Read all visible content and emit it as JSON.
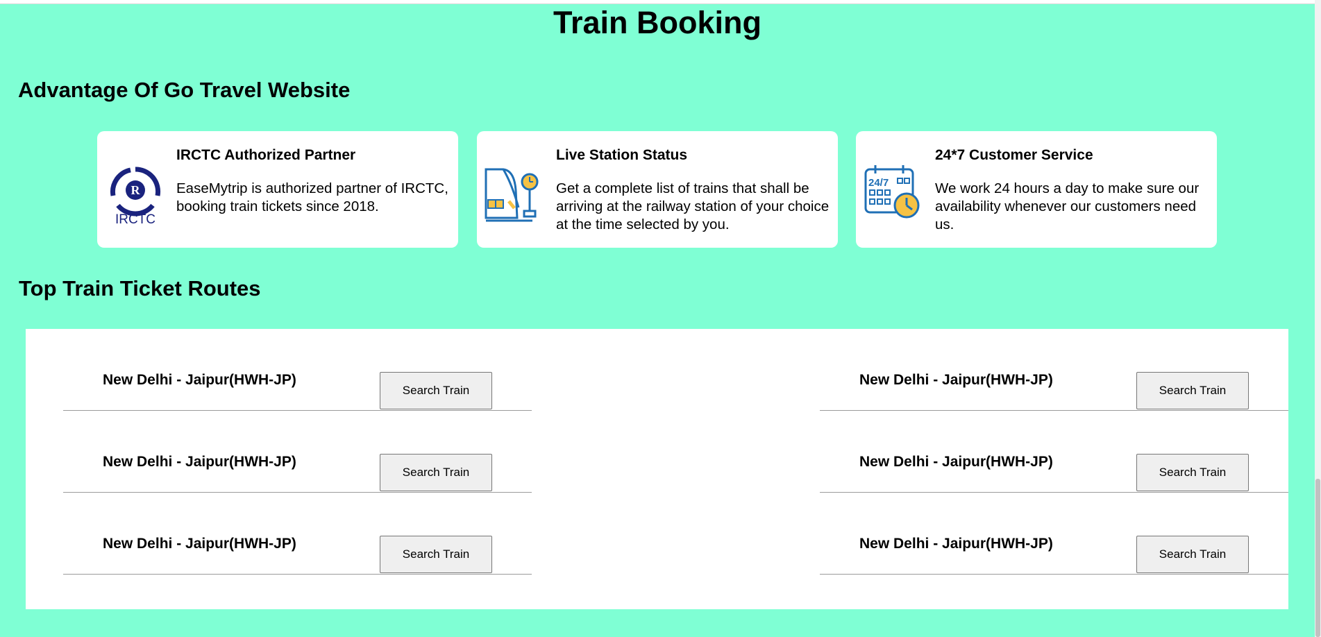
{
  "page": {
    "title": "Train Booking"
  },
  "advantages": {
    "title": "Advantage Of Go Travel Website",
    "cards": [
      {
        "icon": "irctc-logo-icon",
        "icon_text": "IRCTC",
        "heading": "IRCTC Authorized Partner",
        "text": "EaseMytrip is authorized partner of IRCTC, booking train tickets since 2018."
      },
      {
        "icon": "train-station-icon",
        "heading": "Live Station Status",
        "text": "Get a complete list of trains that shall be arriving at the railway station of your choice at the time selected by you."
      },
      {
        "icon": "calendar-clock-icon",
        "icon_text": "24/7",
        "heading": "24*7 Customer Service",
        "text": "We work 24 hours a day to make sure our availability whenever our customers need us."
      }
    ]
  },
  "routes": {
    "title": "Top Train Ticket Routes",
    "button_label": "Search Train",
    "left": [
      {
        "route": "New Delhi - Jaipur(HWH-JP)"
      },
      {
        "route": "New Delhi - Jaipur(HWH-JP)"
      },
      {
        "route": "New Delhi - Jaipur(HWH-JP)"
      }
    ],
    "right": [
      {
        "route": "New Delhi - Jaipur(HWH-JP)"
      },
      {
        "route": "New Delhi - Jaipur(HWH-JP)"
      },
      {
        "route": "New Delhi - Jaipur(HWH-JP)"
      }
    ]
  },
  "colors": {
    "background": "#7fffd4",
    "card": "#ffffff",
    "icon_blue": "#1f6fb5",
    "icon_yellow": "#f6c244",
    "irctc_navy": "#1a237e"
  }
}
